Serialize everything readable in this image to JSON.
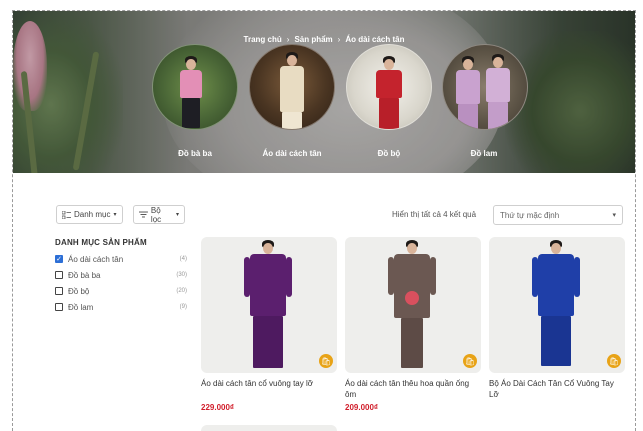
{
  "breadcrumb": [
    "Trang chủ",
    "Sản phẩm",
    "Áo dài cách tân"
  ],
  "categories": [
    {
      "label": "Đồ bà ba"
    },
    {
      "label": "Áo dài cách tân"
    },
    {
      "label": "Đồ bộ"
    },
    {
      "label": "Đồ lam"
    }
  ],
  "toolbar": {
    "categories_label": "Danh mục",
    "filter_label": "Bộ lọc",
    "result_count": "Hiển thị tất cả 4 kết quả",
    "sort_value": "Thứ tự mặc định"
  },
  "sidebar": {
    "title": "DANH MỤC SẢN PHẨM",
    "items": [
      {
        "label": "Áo dài cách tân",
        "count": "(4)",
        "checked": true
      },
      {
        "label": "Đồ bà ba",
        "count": "(30)",
        "checked": false
      },
      {
        "label": "Đồ bộ",
        "count": "(20)",
        "checked": false
      },
      {
        "label": "Đồ lam",
        "count": "(9)",
        "checked": false
      }
    ]
  },
  "products": [
    {
      "name": "Áo dài cách tân cổ vuông tay lỡ",
      "price": "229.000₫"
    },
    {
      "name": "Áo dài cách tân thêu hoa quần ống ôm",
      "price": "209.000₫"
    },
    {
      "name": "Bộ Áo Dài Cách Tân Cổ Vuông Tay Lỡ",
      "price": ""
    }
  ],
  "colors": {
    "price": "#d11e2b",
    "cart_button": "#e8a317",
    "checkbox_active": "#2d6fd6",
    "dress_purple": "#5b1f6e",
    "dress_brown": "#6b5852",
    "dress_blue": "#1f3fa8"
  },
  "icons": {
    "cart": "cart-icon",
    "grid": "grid-icon",
    "filter": "filter-icon",
    "chevron": "chevron-down-icon"
  }
}
